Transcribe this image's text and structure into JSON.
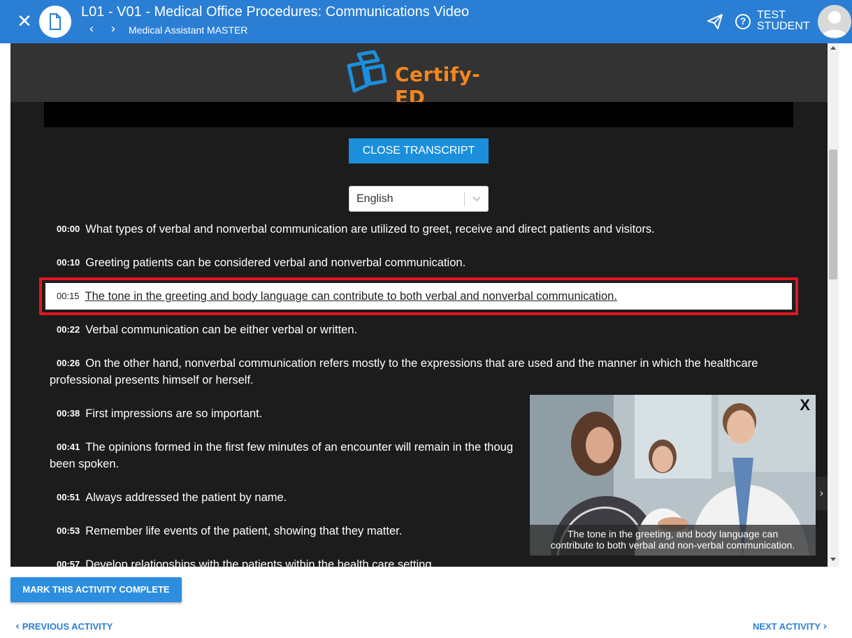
{
  "header": {
    "title": "L01 - V01 - Medical Office Procedures: Communications Video",
    "subtitle": "Medical Assistant MASTER",
    "user_line1": "TEST",
    "user_line2": "STUDENT"
  },
  "logo": {
    "wordmark": "Certify-ED"
  },
  "transcript": {
    "close_label": "CLOSE TRANSCRIPT",
    "language": "English",
    "lines": [
      {
        "ts": "00:00",
        "text": "What types of verbal and nonverbal communication are utilized to greet, receive and direct patients and visitors."
      },
      {
        "ts": "00:10",
        "text": "Greeting patients can be considered verbal and nonverbal communication."
      },
      {
        "ts": "00:15",
        "text": "The tone in the greeting and body language can contribute to both verbal and nonverbal communication."
      },
      {
        "ts": "00:22",
        "text": "Verbal communication can be either verbal or written."
      },
      {
        "ts": "00:26",
        "text": "On the other hand, nonverbal communication refers mostly to the expressions that are used and the manner in which the healthcare",
        "text_cont": "professional presents himself or herself."
      },
      {
        "ts": "00:38",
        "text": "First impressions are so important."
      },
      {
        "ts": "00:41",
        "text": "The opinions formed in the first few minutes of an encounter will remain in the thoug",
        "text_cont": "been spoken."
      },
      {
        "ts": "00:51",
        "text": "Always addressed the patient by name."
      },
      {
        "ts": "00:53",
        "text": "Remember life events of the patient, showing that they matter."
      },
      {
        "ts": "00:57",
        "text": "Develop relationships with the patients within the health care setting."
      }
    ]
  },
  "pip": {
    "close_label": "X",
    "caption_line1": "The tone in the greeting, and body language can",
    "caption_line2": "contribute to both verbal and non-verbal communication."
  },
  "footer": {
    "mark_complete": "MARK THIS ACTIVITY COMPLETE",
    "previous": "PREVIOUS ACTIVITY",
    "next": "NEXT ACTIVITY"
  },
  "colors": {
    "brand_blue": "#2a7fd4",
    "highlight_red": "#e2161f",
    "logo_orange": "#f5871f",
    "logo_blue": "#1b8fdc"
  }
}
